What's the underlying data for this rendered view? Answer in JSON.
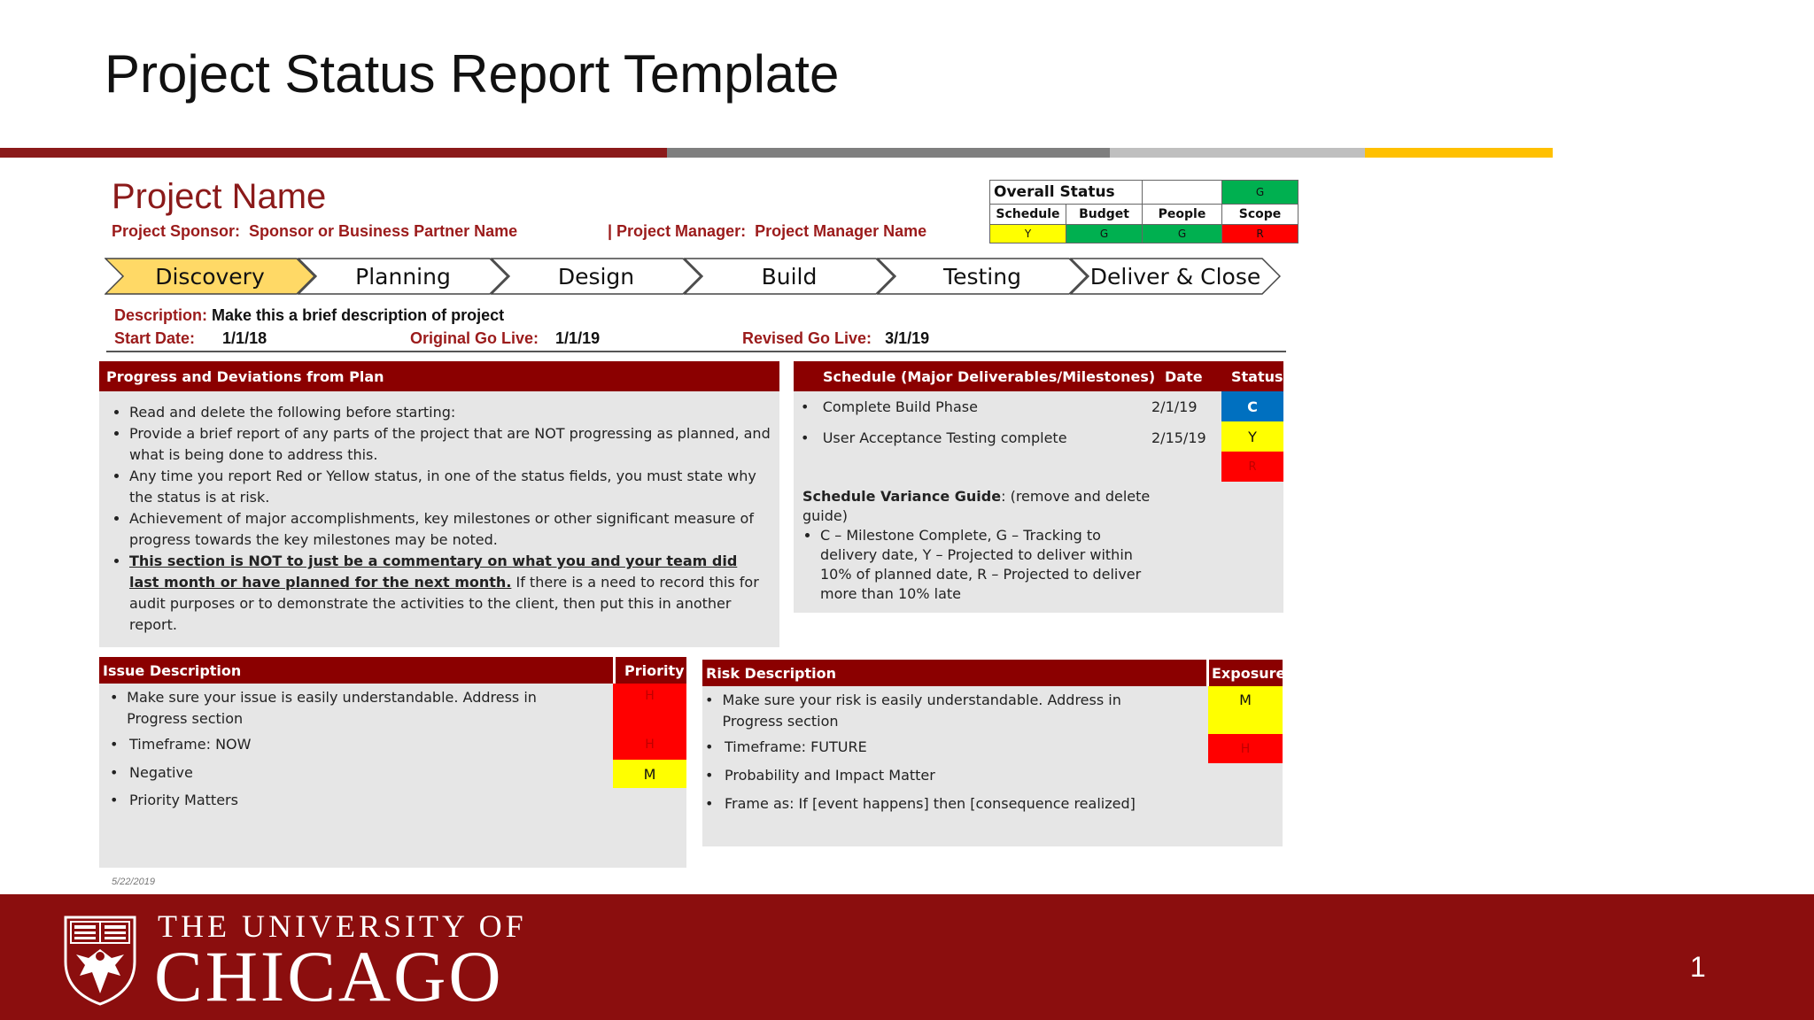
{
  "slide": {
    "title": "Project Status Report Template",
    "page_number": "1",
    "date": "5/22/2019"
  },
  "colors": {
    "maroon": "#8b0000",
    "green": "#00b050",
    "yellow": "#ffff00",
    "red": "#ff0000",
    "blue": "#0070c0",
    "gold": "#ffc000"
  },
  "project": {
    "name": "Project Name",
    "sponsor_label": "Project Sponsor:",
    "sponsor_value": "Sponsor or Business Partner Name",
    "manager_label": "| Project Manager:",
    "manager_value": "Project Manager Name"
  },
  "overall_status": {
    "title": "Overall Status",
    "overall": "G",
    "categories": [
      {
        "label": "Schedule",
        "value": "Y",
        "color": "#ffff00"
      },
      {
        "label": "Budget",
        "value": "G",
        "color": "#00b050"
      },
      {
        "label": "People",
        "value": "G",
        "color": "#00b050"
      },
      {
        "label": "Scope",
        "value": "R",
        "color": "#ff0000"
      }
    ]
  },
  "phases": [
    "Discovery",
    "Planning",
    "Design",
    "Build",
    "Testing",
    "Deliver & Close"
  ],
  "active_phase": "Discovery",
  "meta": {
    "description_label": "Description:",
    "description_value": "Make this a brief description of project",
    "start_label": "Start Date:",
    "start_value": "1/1/18",
    "golive_label": "Original Go Live:",
    "golive_value": "1/1/19",
    "revised_label": "Revised Go Live:",
    "revised_value": "3/1/19"
  },
  "progress": {
    "header": "Progress and Deviations from Plan",
    "items": {
      "b1": "Read and delete the following before starting:",
      "b2": "Provide a brief report of any parts of the project that are NOT progressing as planned, and what is being done to address this.",
      "b3": "Any time you report Red or Yellow status, in one of the status fields, you must state why the status is at risk.",
      "b4": "Achievement of major accomplishments, key milestones or other significant measure of progress towards the key milestones may be noted.",
      "b5_bold": "This section is NOT to just be a commentary on what you and your team did last month or have planned for the next month.",
      "b5_rest": " If there is a need to record this for audit purposes or to demonstrate the activities to the client, then put this in another report."
    }
  },
  "schedule": {
    "header": "Schedule (Major Deliverables/Milestones)",
    "date_header": "Date",
    "status_header": "Status",
    "rows": [
      {
        "item": "Complete Build Phase",
        "date": "2/1/19",
        "status": "C"
      },
      {
        "item": "User Acceptance Testing complete",
        "date": "2/15/19",
        "status": "Y"
      },
      {
        "item": "",
        "date": "",
        "status": "R"
      }
    ],
    "guide_title": "Schedule Variance Guide",
    "guide_title_rest": ": (remove and delete guide)",
    "guide_text": "C – Milestone Complete, G – Tracking to delivery date, Y –  Projected to deliver within 10% of planned date, R – Projected to deliver more than 10% late"
  },
  "issues": {
    "header": "Issue Description",
    "priority_header": "Priority",
    "rows": [
      {
        "text": "Make sure your issue is easily understandable.  Address in Progress section",
        "priority": "H"
      },
      {
        "text": "Timeframe:  NOW",
        "priority": "H"
      },
      {
        "text": "Negative",
        "priority": "M"
      },
      {
        "text": "Priority Matters",
        "priority": ""
      }
    ]
  },
  "risks": {
    "header": "Risk Description",
    "exposure_header": "Exposure",
    "rows": [
      {
        "text": "Make sure your risk is easily understandable. Address in Progress section",
        "exposure": "M"
      },
      {
        "text": "Timeframe:  FUTURE",
        "exposure": "H"
      },
      {
        "text": "Probability and Impact Matter",
        "exposure": ""
      },
      {
        "text": "Frame as:  If [event happens] then [consequence realized]",
        "exposure": ""
      }
    ]
  },
  "footer": {
    "line1": "THE UNIVERSITY OF",
    "line2": "CHICAGO",
    "logo_icon": "university-shield-phoenix-icon"
  }
}
